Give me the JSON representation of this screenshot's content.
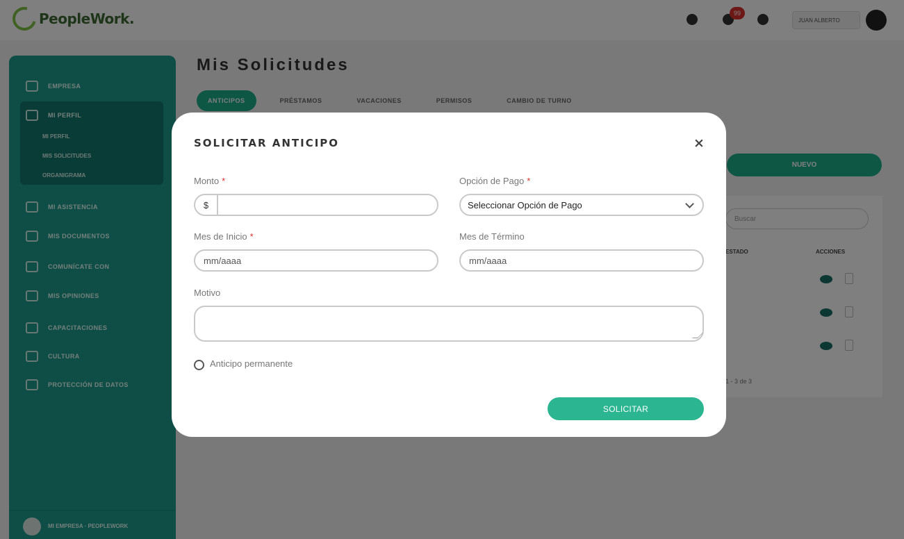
{
  "app": {
    "logo_text": "PeopleWork."
  },
  "header": {
    "notification_count": "99",
    "user_name": "JUAN ALBERTO"
  },
  "sidebar": {
    "items": [
      {
        "label": "EMPRESA"
      },
      {
        "label": "MI PERFIL"
      },
      {
        "label": "MI ASISTENCIA"
      },
      {
        "label": "MIS DOCUMENTOS"
      },
      {
        "label": "COMUNÍCATE CON"
      },
      {
        "label": "MIS OPINIONES"
      },
      {
        "label": "CAPACITACIONES"
      },
      {
        "label": "CULTURA"
      },
      {
        "label": "PROTECCIÓN DE DATOS"
      }
    ],
    "subitems": [
      {
        "label": "MI PERFIL"
      },
      {
        "label": "MIS SOLICITUDES"
      },
      {
        "label": "ORGANIGRAMA"
      }
    ],
    "bottom_label": "MI EMPRESA · PEOPLEWORK"
  },
  "page": {
    "title": "Mis Solicitudes",
    "tabs": [
      {
        "label": "ANTICIPOS"
      },
      {
        "label": "PRÉSTAMOS"
      },
      {
        "label": "VACACIONES"
      },
      {
        "label": "PERMISOS"
      },
      {
        "label": "CAMBIO DE TURNO"
      }
    ],
    "new_button": "NUEVO",
    "search_placeholder": "Buscar",
    "columns": {
      "estado": "ESTADO",
      "acciones": "ACCIONES"
    },
    "pager": "1 - 3 de 3"
  },
  "modal": {
    "title": "SOLICITAR ANTICIPO",
    "close": "×",
    "monto": {
      "label": "Monto",
      "required": "*",
      "prefix": "$",
      "value": ""
    },
    "opcion_pago": {
      "label": "Opción de Pago",
      "required": "*",
      "selected": "Seleccionar Opción de Pago"
    },
    "mes_inicio": {
      "label": "Mes de Inicio",
      "required": "*",
      "placeholder": "mm/aaaa"
    },
    "mes_termino": {
      "label": "Mes de Término",
      "placeholder": "mm/aaaa"
    },
    "motivo": {
      "label": "Motivo",
      "value": ""
    },
    "permanente": {
      "label": "Anticipo permanente"
    },
    "submit": "SOLICITAR"
  }
}
